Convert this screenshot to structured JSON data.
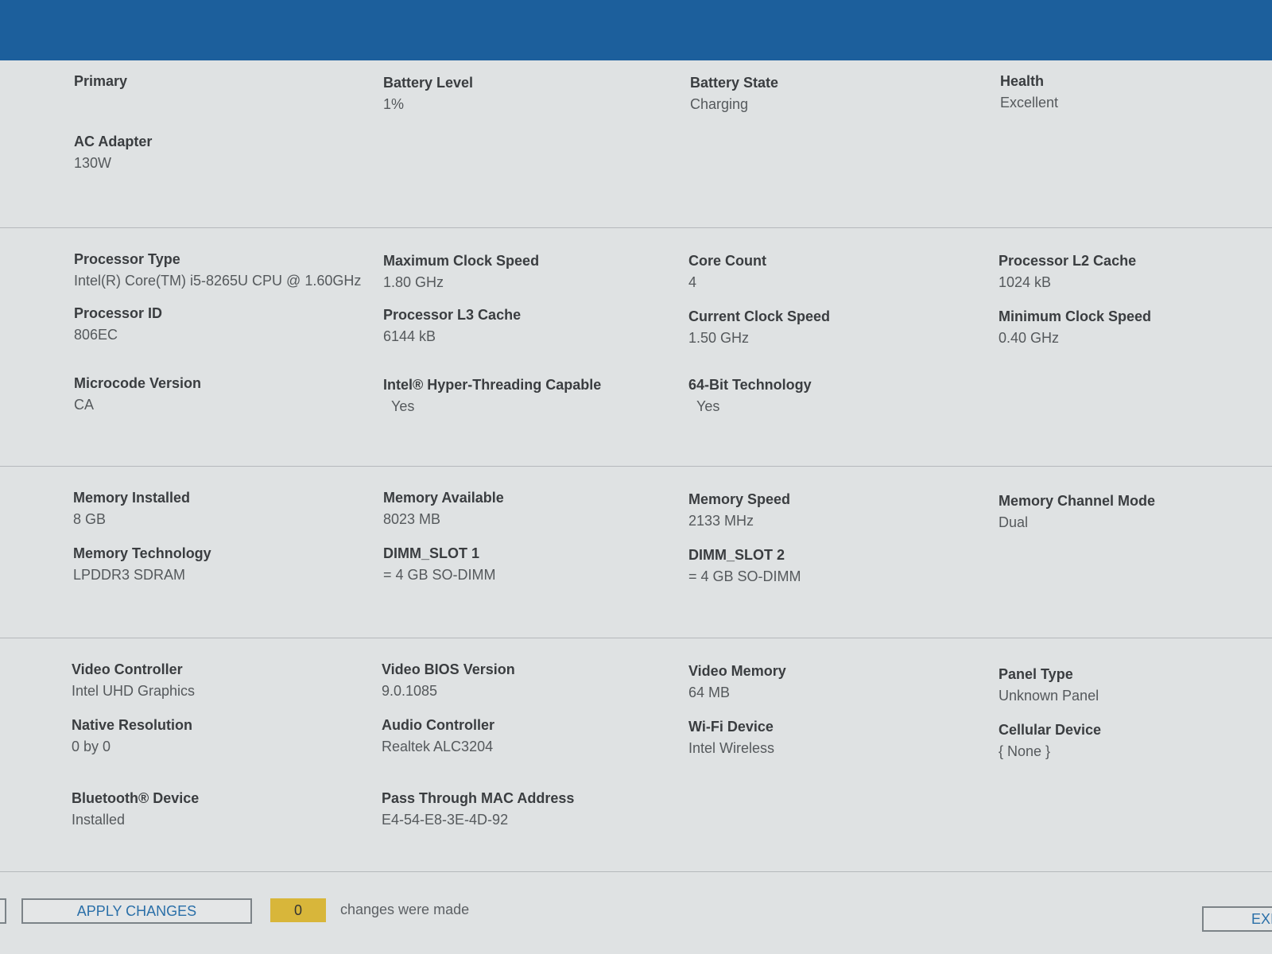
{
  "battery": {
    "primary_label": "Primary",
    "battery_level_label": "Battery Level",
    "battery_level_value": "1%",
    "battery_state_label": "Battery State",
    "battery_state_value": "Charging",
    "health_label": "Health",
    "health_value": "Excellent",
    "ac_adapter_label": "AC Adapter",
    "ac_adapter_value": "130W"
  },
  "processor": {
    "type_label": "Processor Type",
    "type_value": "Intel(R) Core(TM) i5-8265U CPU @ 1.60GHz",
    "max_clock_label": "Maximum Clock Speed",
    "max_clock_value": "1.80 GHz",
    "core_count_label": "Core Count",
    "core_count_value": "4",
    "l2_label": "Processor L2 Cache",
    "l2_value": "1024 kB",
    "id_label": "Processor ID",
    "id_value": "806EC",
    "l3_label": "Processor L3 Cache",
    "l3_value": "6144 kB",
    "current_clock_label": "Current Clock Speed",
    "current_clock_value": "1.50 GHz",
    "min_clock_label": "Minimum Clock Speed",
    "min_clock_value": "0.40 GHz",
    "microcode_label": "Microcode Version",
    "microcode_value": "CA",
    "hyperthreading_label": "Intel® Hyper-Threading Capable",
    "hyperthreading_value": "Yes",
    "bit64_label": "64-Bit Technology",
    "bit64_value": "Yes"
  },
  "memory": {
    "installed_label": "Memory Installed",
    "installed_value": "8 GB",
    "available_label": "Memory Available",
    "available_value": "8023 MB",
    "speed_label": "Memory Speed",
    "speed_value": "2133 MHz",
    "channel_label": "Memory Channel Mode",
    "channel_value": "Dual",
    "technology_label": "Memory Technology",
    "technology_value": "LPDDR3 SDRAM",
    "slot1_label": "DIMM_SLOT 1",
    "slot1_value": "= 4 GB SO-DIMM",
    "slot2_label": "DIMM_SLOT 2",
    "slot2_value": "= 4 GB SO-DIMM"
  },
  "devices": {
    "video_controller_label": "Video Controller",
    "video_controller_value": "Intel UHD Graphics",
    "video_bios_label": "Video BIOS Version",
    "video_bios_value": "9.0.1085",
    "video_memory_label": "Video Memory",
    "video_memory_value": "64 MB",
    "panel_type_label": "Panel Type",
    "panel_type_value": "Unknown Panel",
    "native_res_label": "Native Resolution",
    "native_res_value": "0 by 0",
    "audio_label": "Audio Controller",
    "audio_value": "Realtek ALC3204",
    "wifi_label": "Wi-Fi Device",
    "wifi_value": "Intel Wireless",
    "cellular_label": "Cellular Device",
    "cellular_value": "{ None }",
    "bluetooth_label": "Bluetooth® Device",
    "bluetooth_value": "Installed",
    "mac_label": "Pass Through MAC Address",
    "mac_value": "E4-54-E8-3E-4D-92"
  },
  "footer": {
    "apply_label": "APPLY CHANGES",
    "change_count": "0",
    "changes_text": "changes were made",
    "exit_label": "EXIT"
  },
  "colors": {
    "header_blue": "#1c5f9c",
    "badge_yellow": "#d8b63a",
    "button_text_blue": "#2a6fa8"
  }
}
